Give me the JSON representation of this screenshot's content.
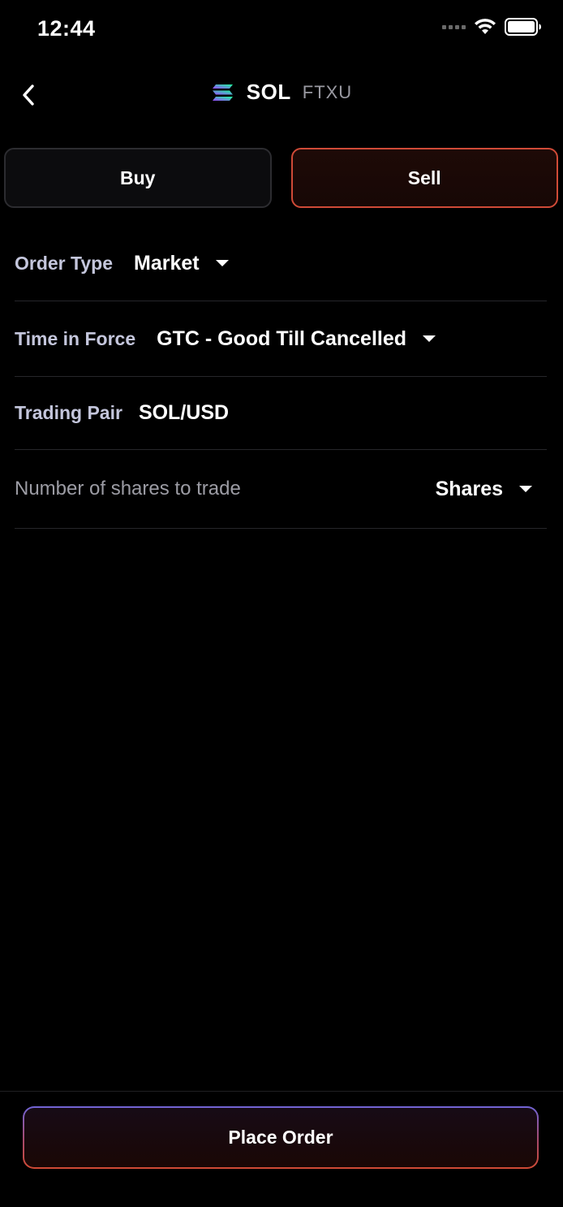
{
  "status_bar": {
    "time": "12:44",
    "icons": [
      "cellular-signal-icon",
      "wifi-icon",
      "battery-icon"
    ]
  },
  "header": {
    "back_icon": "chevron-left-icon",
    "coin_icon": "solana-logo-icon",
    "symbol": "SOL",
    "exchange": "FTXU"
  },
  "side_toggle": {
    "buy_label": "Buy",
    "sell_label": "Sell",
    "selected": "Sell"
  },
  "form": {
    "order_type": {
      "label": "Order Type",
      "value": "Market"
    },
    "time_in_force": {
      "label": "Time in Force",
      "value": "GTC - Good Till Cancelled"
    },
    "trading_pair": {
      "label": "Trading Pair",
      "value": "SOL/USD"
    },
    "quantity": {
      "placeholder": "Number of shares to trade",
      "value": "",
      "unit": "Shares"
    }
  },
  "actions": {
    "place_order_label": "Place Order"
  },
  "colors": {
    "background": "#000000",
    "sell_border": "#cf4a37",
    "label": "#c4c6dc",
    "gradient_start": "#7064d6",
    "gradient_end": "#d04a34"
  }
}
